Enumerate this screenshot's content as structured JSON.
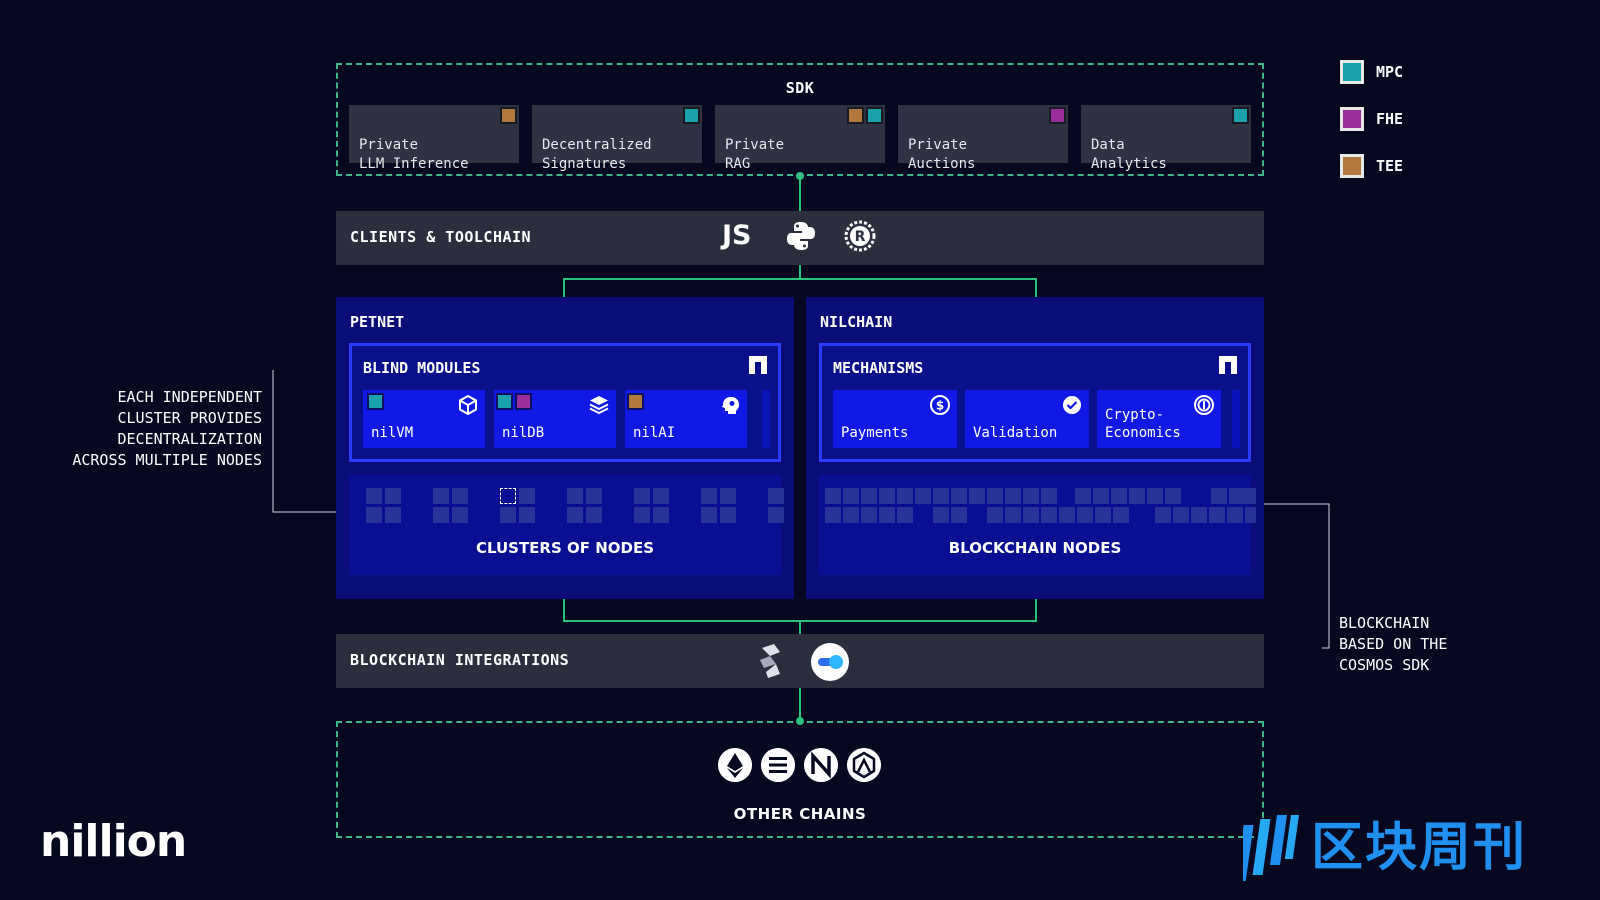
{
  "sdk": {
    "title": "SDK",
    "cards": [
      {
        "label": "Private\nLLM Inference",
        "tags": [
          "TEE"
        ]
      },
      {
        "label": "Decentralized\nSignatures",
        "tags": [
          "MPC"
        ]
      },
      {
        "label": "Private\nRAG",
        "tags": [
          "TEE",
          "MPC"
        ]
      },
      {
        "label": "Private\nAuctions",
        "tags": [
          "FHE"
        ]
      },
      {
        "label": "Data\nAnalytics",
        "tags": [
          "MPC"
        ]
      }
    ]
  },
  "legend": [
    {
      "label": "MPC",
      "color": "#1aa3ad"
    },
    {
      "label": "FHE",
      "color": "#9a2e9c"
    },
    {
      "label": "TEE",
      "color": "#b17a3c"
    }
  ],
  "clients": {
    "title": "CLIENTS & TOOLCHAIN",
    "js_label": "JS",
    "icons": [
      "javascript-icon",
      "python-icon",
      "rust-icon"
    ]
  },
  "petnet": {
    "title": "PETNET",
    "blind_modules": {
      "title": "BLIND MODULES",
      "modules": [
        {
          "label": "nilVM",
          "tags": [
            "MPC"
          ],
          "icon": "cube-icon"
        },
        {
          "label": "nilDB",
          "tags": [
            "MPC",
            "FHE"
          ],
          "icon": "layers-icon"
        },
        {
          "label": "nilAI",
          "tags": [
            "TEE"
          ],
          "icon": "ai-head-icon"
        }
      ]
    },
    "nodes_label": "CLUSTERS OF NODES"
  },
  "nilchain": {
    "title": "NILCHAIN",
    "mechanisms": {
      "title": "MECHANISMS",
      "items": [
        {
          "label": "Payments",
          "icon": "dollar-coin-icon"
        },
        {
          "label": "Validation",
          "icon": "check-circle-icon"
        },
        {
          "label": "Crypto-\nEconomics",
          "icon": "token-coin-icon"
        }
      ]
    },
    "nodes_label": "BLOCKCHAIN NODES"
  },
  "integrations": {
    "title": "BLOCKCHAIN INTEGRATIONS",
    "icons": [
      "chainlink-style-icon",
      "toggle-bridge-icon"
    ]
  },
  "other_chains": {
    "title": "OTHER CHAINS",
    "icons": [
      "ethereum-icon",
      "solana-icon",
      "near-icon",
      "arbitrum-icon"
    ]
  },
  "annotations": {
    "left": "EACH INDEPENDENT\nCLUSTER PROVIDES\nDECENTRALIZATION\nACROSS MULTIPLE NODES",
    "right": "BLOCKCHAIN\nBASED ON THE\nCOSMOS SDK"
  },
  "brand": {
    "logo": "nillion",
    "watermark": "区块周刊"
  }
}
